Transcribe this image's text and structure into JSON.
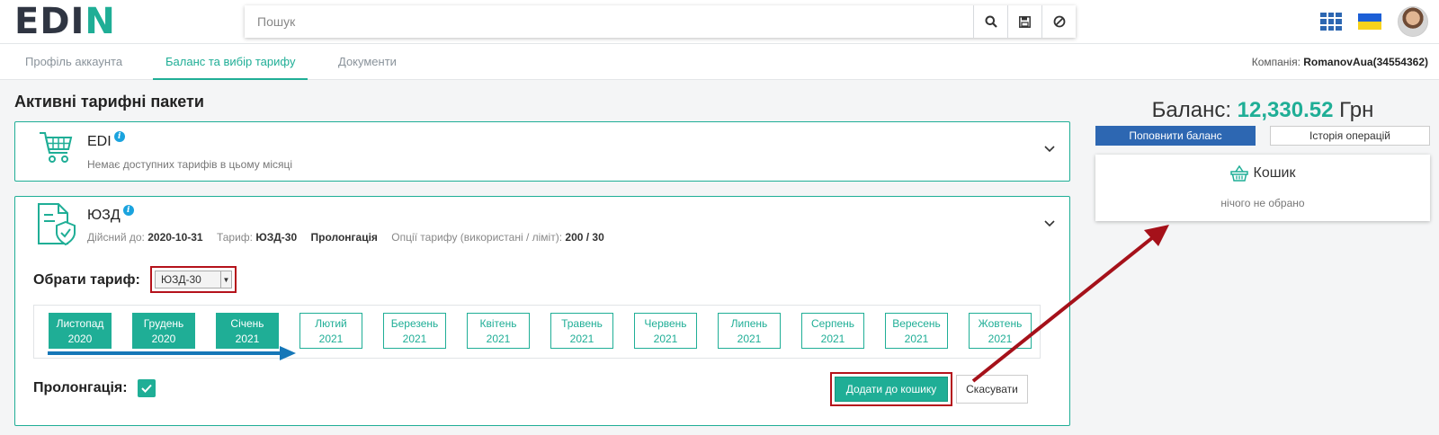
{
  "header": {
    "logo_left": "ED",
    "logo_right": "N",
    "logo_mid": "I",
    "search_placeholder": "Пошук"
  },
  "tabs": [
    {
      "label": "Профіль аккаунта",
      "active": false
    },
    {
      "label": "Баланс та вибір тарифу",
      "active": true
    },
    {
      "label": "Документи",
      "active": false
    }
  ],
  "company": {
    "label": "Компанія:",
    "value": "RomanovAua(34554362)"
  },
  "page_title": "Активні тарифні пакети",
  "edi": {
    "title": "EDI",
    "subtitle": "Немає доступних тарифів в цьому місяці"
  },
  "uzd": {
    "title": "ЮЗД",
    "valid_label": "Дійсний до:",
    "valid_value": "2020-10-31",
    "tariff_label": "Тариф:",
    "tariff_value": "ЮЗД-30",
    "prolong_text": "Пролонгація",
    "options_label": "Опції тарифу (використані / ліміт):",
    "options_value": "200 / 30",
    "choose_label": "Обрати тариф:",
    "selected_tariff": "ЮЗД-30",
    "prolong_label": "Пролонгація:",
    "prolong_checked": true,
    "add_button": "Додати до кошику",
    "cancel_button": "Скасувати",
    "months": [
      {
        "name": "Листопад",
        "year": "2020",
        "selected": true
      },
      {
        "name": "Грудень",
        "year": "2020",
        "selected": true
      },
      {
        "name": "Січень",
        "year": "2021",
        "selected": true
      },
      {
        "name": "Лютий",
        "year": "2021",
        "selected": false
      },
      {
        "name": "Березень",
        "year": "2021",
        "selected": false
      },
      {
        "name": "Квітень",
        "year": "2021",
        "selected": false
      },
      {
        "name": "Травень",
        "year": "2021",
        "selected": false
      },
      {
        "name": "Червень",
        "year": "2021",
        "selected": false
      },
      {
        "name": "Липень",
        "year": "2021",
        "selected": false
      },
      {
        "name": "Серпень",
        "year": "2021",
        "selected": false
      },
      {
        "name": "Вересень",
        "year": "2021",
        "selected": false
      },
      {
        "name": "Жовтень",
        "year": "2021",
        "selected": false
      }
    ]
  },
  "balance": {
    "label": "Баланс:",
    "amount": "12,330.52",
    "currency": "Грн",
    "topup_button": "Поповнити баланс",
    "history_button": "Історія операцій"
  },
  "cart": {
    "title": "Кошик",
    "empty_text": "нічого не обрано"
  },
  "colors": {
    "accent": "#1fae96",
    "primary_blue": "#2d67b2",
    "highlight_red": "#b5121b",
    "arrow_blue": "#1577b8"
  }
}
